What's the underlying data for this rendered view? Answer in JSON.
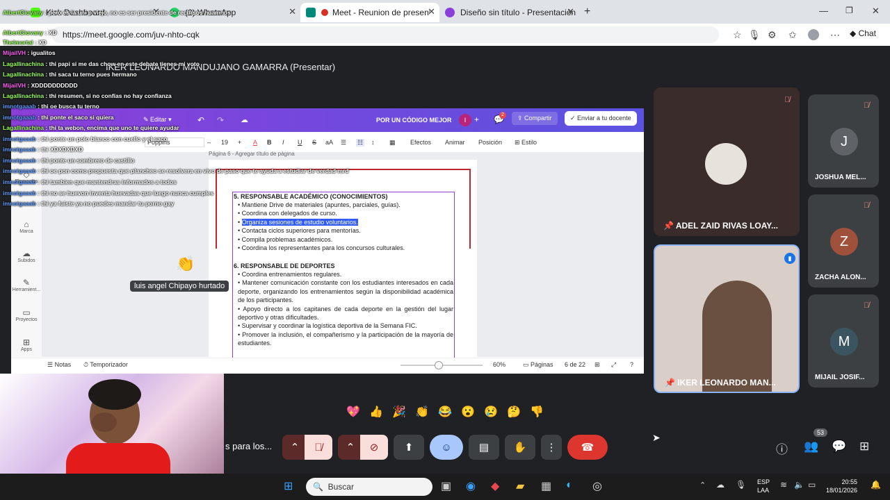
{
  "browser": {
    "tabs": [
      {
        "title": "Kick Dashboard",
        "favicon_color": "#53fc18"
      },
      {
        "title": "(2) WhatsApp",
        "favicon_color": "#25d366"
      },
      {
        "title": "Meet - Reunion de presentaci",
        "favicon_color": "#00897b"
      },
      {
        "title": "Diseño sin título - Presentación",
        "favicon_color": "#8b3fd9"
      }
    ],
    "url": "https://meet.google.com/juv-nhto-cqk",
    "chat_label": "Chat"
  },
  "meet": {
    "presenter_title": "IKER LEONARDO MANDUJANO GAMARRA (Presentar)",
    "participants": [
      {
        "name": "ADEL ZAID RIVAS LOAY...",
        "pinned": true
      },
      {
        "name": "IKER LEONARDO MAN...",
        "pinned": true
      },
      {
        "name": "JOSHUA MEL...",
        "initial": "J",
        "color": "#5f6368"
      },
      {
        "name": "ZACHA ALON...",
        "initial": "Z",
        "color": "#a0513c"
      },
      {
        "name": "MIJAIL JOSIF...",
        "initial": "M",
        "color": "#3b5560"
      }
    ],
    "reaction_name": "luis angel Chipayo hurtado",
    "caption_text": "s para los...",
    "people_count": "53",
    "emojis": [
      "💖",
      "👍",
      "🎉",
      "👏",
      "😂",
      "😮",
      "😢",
      "🤔",
      "👎"
    ]
  },
  "canva": {
    "edit_label": "Editar",
    "banner": "POR UN CÓDIGO MEJOR",
    "share_label": "Compartir",
    "send_label": "Enviar a tu docente",
    "notif_count": "2",
    "font_name": "Poppins",
    "font_size": "19",
    "tool_effects": "Efectos",
    "tool_animate": "Animar",
    "tool_position": "Posición",
    "tool_style": "Estilo",
    "page_header": "Página 6 - Agregar título de página",
    "rail": [
      "Elementos",
      "Marca",
      "Subidos",
      "Herramient...",
      "Proyectos",
      "Apps"
    ],
    "notes_label": "Notas",
    "timer_label": "Temporizador",
    "zoom": "60%",
    "pages_label": "Páginas",
    "page_count": "6 de 22",
    "section5_title": "5. RESPONSABLE ACADÉMICO (CONOCIMIENTOS)",
    "section5_items": [
      "Mantiene Drive de materiales (apuntes, parciales, guías).",
      "Coordina con delegados de curso.",
      "Organiza sesiones de estudio voluntarios.",
      "Contacta ciclos superiores para mentorías.",
      "Compila problemas académicos.",
      "Coordina los representantes para los concursos culturales."
    ],
    "section6_title": "6. RESPONSABLE DE DEPORTES",
    "section6_items": [
      "Coordina entrenamientos regulares.",
      "Mantener comunicación constante con los estudiantes interesados en cada deporte, organizando los entrenamientos según la disponibilidad académica de los participantes.",
      "Apoyo directo a los capitanes de cada deporte en la gestión del lugar deportivo y otras dificultades.",
      "Supervisar y coordinar la logística deportiva de la Semana FIC.",
      "Promover la inclusión, el compañerismo y la participación de la mayoría de estudiantes."
    ]
  },
  "chat_overlay": [
    {
      "user": "AlbertGiovany",
      "msg": "pero es la uni p viejo, no es ser presidente de recursos huamnos"
    },
    {
      "user": "AlbertGiovany",
      "msg": "XD"
    },
    {
      "user": "Thelmortal",
      "msg": "XD"
    },
    {
      "user": "MijailVH",
      "msg": "igualitos"
    },
    {
      "user": "Lagallinachina",
      "msg": "thi papi si me das chow en este debate tienes mi voto"
    },
    {
      "user": "Lagallinachina",
      "msg": "thi saca tu terno pues hermano"
    },
    {
      "user": "MijailVH",
      "msg": "XDDDDDDDDDD"
    },
    {
      "user": "Lagallinachina",
      "msg": "thi resumen, si no confías no hay confianza"
    },
    {
      "user": "imnotgaaab",
      "msg": "thi oe busca tu terno"
    },
    {
      "user": "imnotgaaab",
      "msg": "thi ponte el saco si quiera"
    },
    {
      "user": "Lagallinachina",
      "msg": "thi ta webon, encima que uno te quiere ayudar"
    },
    {
      "user": "imnotgaaab",
      "msg": "thi ponte un polo blanco con cuello y el saco"
    },
    {
      "user": "imnotgaaab",
      "msg": "thi XDXDXDXD"
    },
    {
      "user": "imnotgaaab",
      "msg": "thi ponte un sombrero de castillo"
    },
    {
      "user": "imnotgaaab",
      "msg": "thi oe pon como propuesta que plancheo se resolvera en vivo de paso que te ayuda a estudiar de verdad mrd"
    },
    {
      "user": "imnotgaaab",
      "msg": "thi tambien que mantendras informados a todos"
    },
    {
      "user": "imnotgaaab",
      "msg": "thi no se huevon inventa huevadas que luego nunca cumples"
    },
    {
      "user": "imnotgaaab",
      "msg": "thi ya fuiste ya no puedes mandar tu porno gay"
    }
  ],
  "taskbar": {
    "search_placeholder": "Buscar",
    "lang": "ESP",
    "lang2": "LAA",
    "time": "20:55",
    "date": "18/01/2026"
  }
}
